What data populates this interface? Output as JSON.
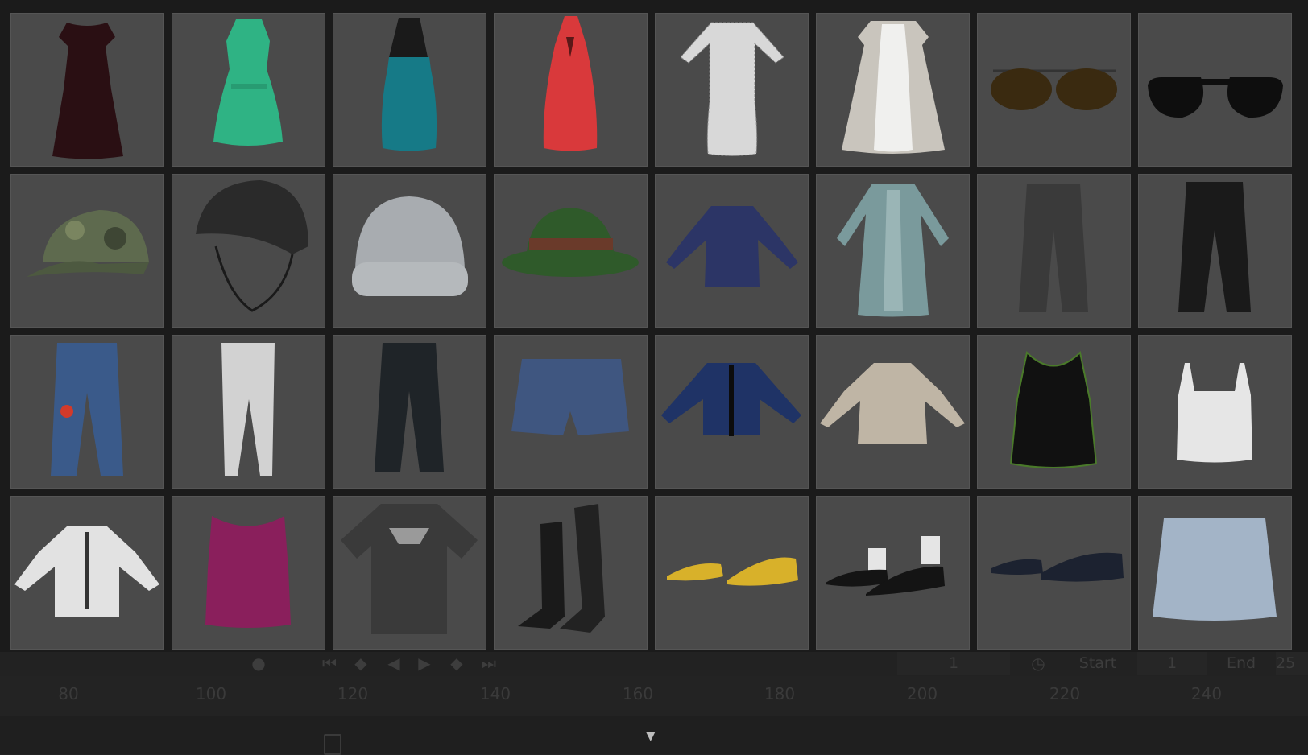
{
  "timeline": {
    "current_frame": "1",
    "start_label": "Start",
    "start_value": "1",
    "end_label": "End",
    "end_value": "25",
    "ruler_ticks": [
      "80",
      "100",
      "120",
      "140",
      "160",
      "180",
      "200",
      "220",
      "240"
    ]
  },
  "assets": [
    {
      "name": "dark-red-dress",
      "color": "#2a0f13"
    },
    {
      "name": "green-sleeveless-dress",
      "color": "#2fb384"
    },
    {
      "name": "teal-halter-dress",
      "color": "#167a87"
    },
    {
      "name": "red-halter-dress",
      "color": "#d9393b"
    },
    {
      "name": "tweed-dress",
      "color": "#d8d8d8"
    },
    {
      "name": "white-gown-coat",
      "color": "#c9c5bd"
    },
    {
      "name": "aviator-sunglasses",
      "color": "#3a2a10"
    },
    {
      "name": "black-sunglasses",
      "color": "#0e0e0e"
    },
    {
      "name": "camo-cap",
      "color": "#5e6a4e"
    },
    {
      "name": "riding-helmet",
      "color": "#2a2a2a"
    },
    {
      "name": "knit-beanie",
      "color": "#a8acb0"
    },
    {
      "name": "green-bucket-hat",
      "color": "#2f5a2a"
    },
    {
      "name": "denim-jacket",
      "color": "#2c3566"
    },
    {
      "name": "long-teal-coat",
      "color": "#7a9a9c"
    },
    {
      "name": "distressed-jeans",
      "color": "#3a3a3a"
    },
    {
      "name": "black-pants",
      "color": "#1a1a1a"
    },
    {
      "name": "embroidered-jeans",
      "color": "#3a5a8a"
    },
    {
      "name": "white-leggings",
      "color": "#d2d2d2"
    },
    {
      "name": "dark-jeans",
      "color": "#1f2428"
    },
    {
      "name": "denim-shorts",
      "color": "#3f5680"
    },
    {
      "name": "blue-cardigan",
      "color": "#1f3366"
    },
    {
      "name": "beige-sweater",
      "color": "#bfb5a5"
    },
    {
      "name": "black-tank-top",
      "color": "#111111"
    },
    {
      "name": "white-camisole",
      "color": "#e6e6e6"
    },
    {
      "name": "white-ruffle-blouse",
      "color": "#e2e2e2"
    },
    {
      "name": "magenta-knit-top",
      "color": "#8a1f5c"
    },
    {
      "name": "chainmail-tshirt",
      "color": "#3a3a3a"
    },
    {
      "name": "riding-boots",
      "color": "#1a1a1a"
    },
    {
      "name": "yellow-sneakers",
      "color": "#d8b12a"
    },
    {
      "name": "black-dress-shoes",
      "color": "#141414"
    },
    {
      "name": "dark-sneakers",
      "color": "#1c2230"
    },
    {
      "name": "denim-skirt",
      "color": "#a3b4c7"
    }
  ]
}
